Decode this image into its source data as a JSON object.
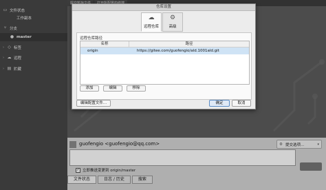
{
  "window": {
    "tabs": [
      "提交暂存文件",
      "打开所配置的终端"
    ]
  },
  "sidebar": {
    "items": [
      {
        "label": "文件状态",
        "icon": "folder-icon"
      },
      {
        "label": "工作副本",
        "icon": ""
      },
      {
        "label": "分支",
        "icon": "branch-icon"
      },
      {
        "label": "master",
        "icon": ""
      },
      {
        "label": "标签",
        "icon": "tag-icon"
      },
      {
        "label": "远程",
        "icon": "cloud-icon"
      },
      {
        "label": "贮藏",
        "icon": "stash-icon"
      }
    ]
  },
  "commit_panel": {
    "author": "guofengio <guofengio@qq.com>",
    "options_label": "提交选项...",
    "push_checkbox_label": "立即推送变更到 origin/master",
    "push_checked": true,
    "tabs": [
      "文件状态",
      "日志 / 历史",
      "搜索"
    ],
    "active_tab": 0
  },
  "dialog": {
    "title": "仓库设置",
    "tabs": [
      {
        "label": "远程仓库",
        "icon": "cloud-icon",
        "active": true
      },
      {
        "label": "高级",
        "icon": "gear-icon",
        "active": false
      }
    ],
    "group_label": "远程仓库路径",
    "columns": {
      "name": "名称",
      "path": "路径"
    },
    "remotes": [
      {
        "name": "origin",
        "path": "https://gitee.com/guofengio/ald.1001ald.git"
      }
    ],
    "buttons": {
      "add": "添加",
      "edit": "编辑",
      "remove": "移除",
      "edit_config": "编辑配置文件...",
      "ok": "确定",
      "cancel": "取消"
    }
  },
  "colors": {
    "sidebar_bg": "#474747",
    "main_bg": "#5d5d5d",
    "dialog_bg": "#ececec",
    "selected_row": "#cfe3f5",
    "ok_border": "#5b8cc5"
  }
}
